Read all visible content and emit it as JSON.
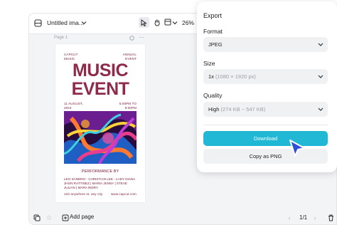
{
  "topbar": {
    "document_title": "Untitled ima...",
    "zoom": "26%",
    "icons": [
      "layers-icon",
      "chevron-down-icon",
      "pointer-icon",
      "hand-icon",
      "chevron-down-icon",
      "frame-icon",
      "chevron-down-icon"
    ]
  },
  "canvas": {
    "page_label": "Page 1",
    "poster": {
      "brand_left": "CAPCUT\nMUSIC",
      "brand_right": "ANNUAL\nEVENT",
      "headline_line1": "MUSIC",
      "headline_line2": "EVENT",
      "date": "11 AUGUST,\n2024",
      "time": "5:00PM TO\n9:00PM",
      "performance_by": "PERFORMANCE BY",
      "performers": "LEO SANDRO - CHRISTIAN LEE - LADY DIANA\nJHON RATTINEZ | MARIA JENNY | STEVE\nJULIAN | MARA INDRY",
      "address": "123 anywhere st, any city",
      "website": "www.capcut.com"
    }
  },
  "bottombar": {
    "add_page_label": "Add page",
    "page_count": "1/1"
  },
  "export_panel": {
    "title": "Export",
    "format_label": "Format",
    "format_value": "JPEG",
    "size_label": "Size",
    "size_value": "1x",
    "size_hint": "(1080 × 1920 px)",
    "quality_label": "Quality",
    "quality_value": "High",
    "quality_hint": "(274 KB ~ 547 KB)",
    "download_label": "Download",
    "copy_label": "Copy as PNG"
  },
  "colors": {
    "accent": "#20b8d4",
    "poster_text": "#8f2a4a",
    "cursor": "#2c50d6"
  }
}
